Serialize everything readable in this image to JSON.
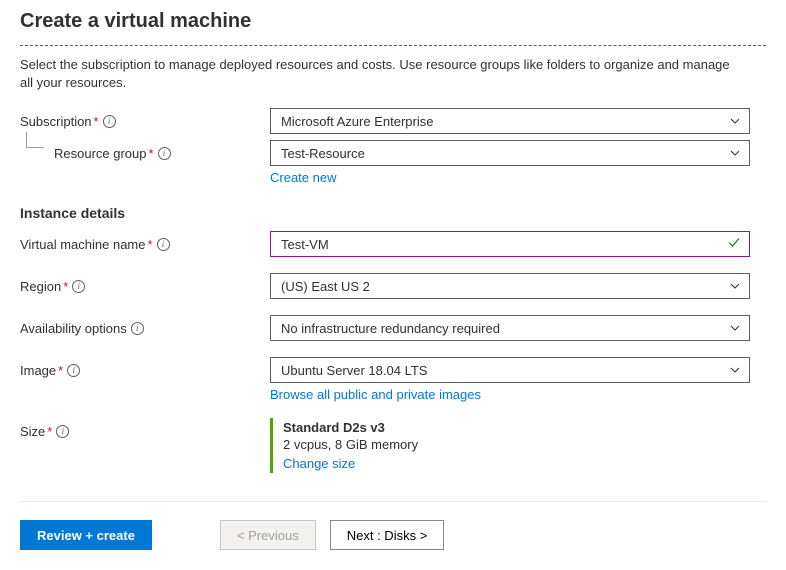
{
  "page": {
    "title": "Create a virtual machine",
    "intro": "Select the subscription to manage deployed resources and costs. Use resource groups like folders to organize and manage all your resources."
  },
  "labels": {
    "subscription": "Subscription",
    "resource_group": "Resource group",
    "instance_details": "Instance details",
    "vm_name": "Virtual machine name",
    "region": "Region",
    "availability": "Availability options",
    "image": "Image",
    "size": "Size"
  },
  "values": {
    "subscription": "Microsoft Azure Enterprise",
    "resource_group": "Test-Resource",
    "vm_name": "Test-VM",
    "region": "(US) East US 2",
    "availability": "No infrastructure redundancy required",
    "image": "Ubuntu Server 18.04 LTS"
  },
  "links": {
    "create_new": "Create new",
    "browse_images": "Browse all public and private images",
    "change_size": "Change size"
  },
  "size": {
    "name": "Standard D2s v3",
    "detail": "2 vcpus, 8 GiB memory"
  },
  "buttons": {
    "review": "Review + create",
    "previous": "< Previous",
    "next": "Next : Disks >"
  }
}
